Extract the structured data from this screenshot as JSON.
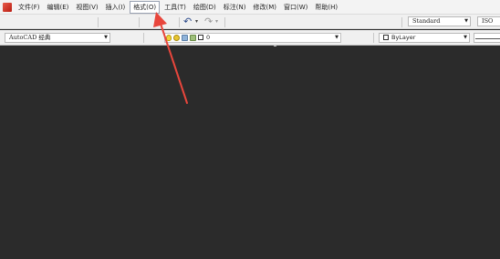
{
  "menubar": {
    "items": [
      {
        "label": "文件(F)"
      },
      {
        "label": "编辑(E)"
      },
      {
        "label": "视图(V)"
      },
      {
        "label": "插入(I)"
      },
      {
        "label": "格式(O)"
      },
      {
        "label": "工具(T)"
      },
      {
        "label": "绘图(D)"
      },
      {
        "label": "标注(N)"
      },
      {
        "label": "修改(M)"
      },
      {
        "label": "窗口(W)"
      },
      {
        "label": "帮助(H)"
      }
    ],
    "active_item": "格式(O)"
  },
  "toolbar": {
    "text_style": "Standard",
    "dim_style": "ISO"
  },
  "workspace": {
    "selected": "AutoCAD 经典"
  },
  "layers": {
    "current": "0"
  },
  "properties": {
    "color": "ByLayer"
  },
  "annotation": {
    "arrow_color": "#e8463c"
  },
  "icons": [
    "app-icon",
    "undo-icon",
    "redo-icon",
    "lightbulb-icon",
    "sun-icon",
    "lock-icon",
    "plot-icon",
    "color-square-icon"
  ]
}
